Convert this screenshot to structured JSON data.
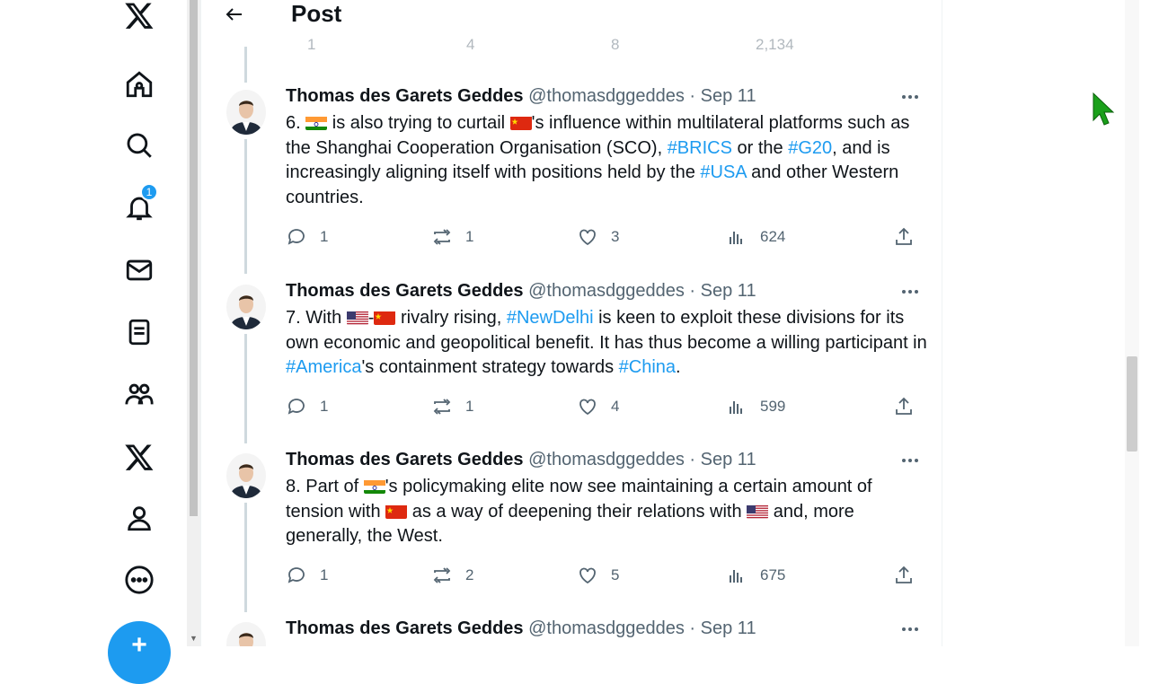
{
  "header": {
    "title": "Post"
  },
  "nav": {
    "items": [
      {
        "icon": "x-logo-icon"
      },
      {
        "icon": "home-icon"
      },
      {
        "icon": "search-icon"
      },
      {
        "icon": "notifications-icon",
        "badge": "1"
      },
      {
        "icon": "messages-icon"
      },
      {
        "icon": "lists-icon"
      },
      {
        "icon": "communities-icon"
      },
      {
        "icon": "premium-x-icon"
      },
      {
        "icon": "profile-icon"
      },
      {
        "icon": "more-icon"
      }
    ],
    "notification_badge": "1",
    "post_button_glyph": "+"
  },
  "partial_stats": {
    "replies": "1",
    "reposts": "4",
    "likes": "8",
    "views": "2,134"
  },
  "tweets": [
    {
      "name": "Thomas des Garets Geddes",
      "handle": "@thomasdggeddes",
      "sep": "·",
      "date": "Sep 11",
      "text_parts": [
        "6. ",
        "[IN]",
        " is also trying to curtail ",
        "[CN]",
        "'s influence within multilateral platforms such as the Shanghai Cooperation Organisation (SCO), ",
        "#BRICS",
        " or the ",
        "#G20",
        ", and is increasingly aligning itself with positions held by the ",
        "#USA",
        " and other Western countries."
      ],
      "replies": "1",
      "reposts": "1",
      "likes": "3",
      "views": "624"
    },
    {
      "name": "Thomas des Garets Geddes",
      "handle": "@thomasdggeddes",
      "sep": "·",
      "date": "Sep 11",
      "text_parts": [
        "7. With ",
        "[US]",
        "-",
        "[CN]",
        " rivalry rising, ",
        "#NewDelhi",
        " is keen to exploit these divisions for its own economic and geopolitical benefit. It has thus become a willing participant in ",
        "#America",
        "'s containment strategy towards ",
        "#China",
        "."
      ],
      "replies": "1",
      "reposts": "1",
      "likes": "4",
      "views": "599"
    },
    {
      "name": "Thomas des Garets Geddes",
      "handle": "@thomasdggeddes",
      "sep": "·",
      "date": "Sep 11",
      "text_parts": [
        "8. Part of ",
        "[IN]",
        "'s policymaking elite now see maintaining a certain amount of tension with ",
        "[CN]",
        " as a way of deepening their relations with ",
        "[US]",
        " and, more generally, the West."
      ],
      "replies": "1",
      "reposts": "2",
      "likes": "5",
      "views": "675"
    },
    {
      "name": "Thomas des Garets Geddes",
      "handle": "@thomasdggeddes",
      "sep": "·",
      "date": "Sep 11"
    }
  ],
  "colors": {
    "accent": "#1d9bf0",
    "text": "#0f1419",
    "muted": "#536471",
    "cursor": "#1aa01a"
  }
}
